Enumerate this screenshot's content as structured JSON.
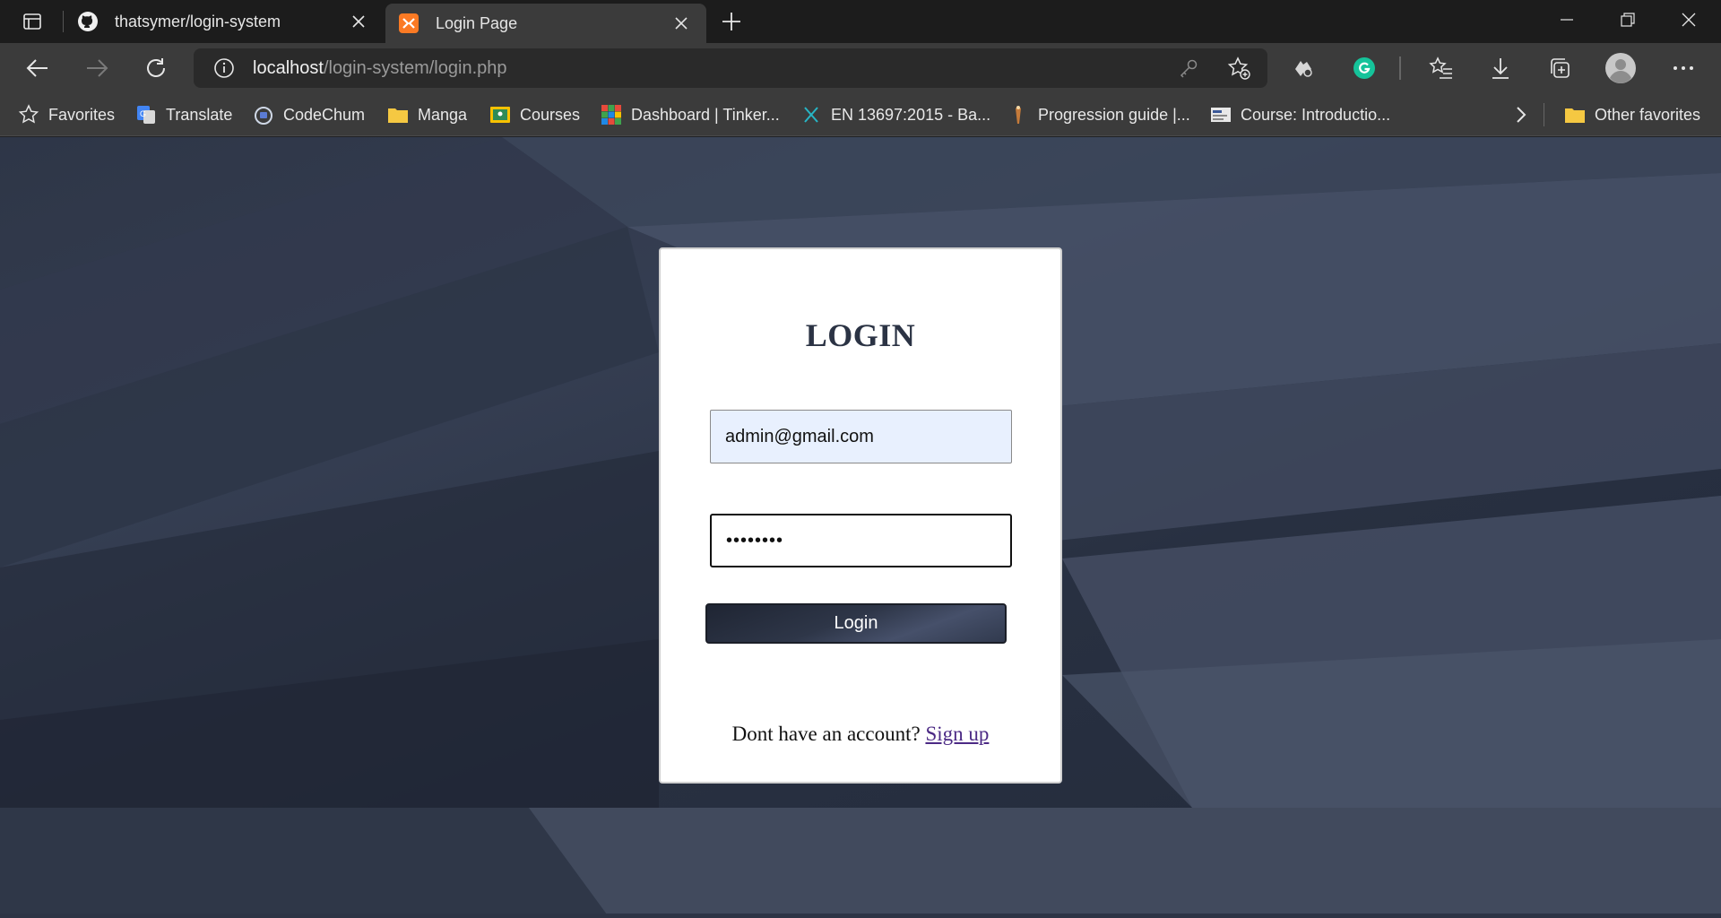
{
  "browser": {
    "tabs": [
      {
        "title": "thatsymer/login-system",
        "favicon": "github-icon",
        "active": false
      },
      {
        "title": "Login Page",
        "favicon": "xampp-icon",
        "active": true
      }
    ],
    "url_host": "localhost",
    "url_path": "/login-system/login.php"
  },
  "bookmarks": {
    "items": [
      {
        "label": "Favorites",
        "icon": "star-outline-icon"
      },
      {
        "label": "Translate",
        "icon": "translate-icon"
      },
      {
        "label": "CodeChum",
        "icon": "codechum-icon"
      },
      {
        "label": "Manga",
        "icon": "folder-icon"
      },
      {
        "label": "Courses",
        "icon": "classroom-icon"
      },
      {
        "label": "Dashboard | Tinker...",
        "icon": "tinkercad-icon"
      },
      {
        "label": "EN 13697:2015 - Ba...",
        "icon": "link-icon"
      },
      {
        "label": "Progression guide |...",
        "icon": "guide-icon"
      },
      {
        "label": "Course: Introductio...",
        "icon": "course-icon"
      }
    ],
    "other_label": "Other favorites"
  },
  "login": {
    "title": "LOGIN",
    "email_value": "admin@gmail.com",
    "password_value": "••••••••",
    "button_label": "Login",
    "signup_prompt": "Dont have an account?",
    "signup_link": "Sign up"
  },
  "colors": {
    "accent_dark": "#2b3344",
    "background": "#2e3647",
    "link": "#4c2a85",
    "autofill": "#e8f0fe"
  }
}
